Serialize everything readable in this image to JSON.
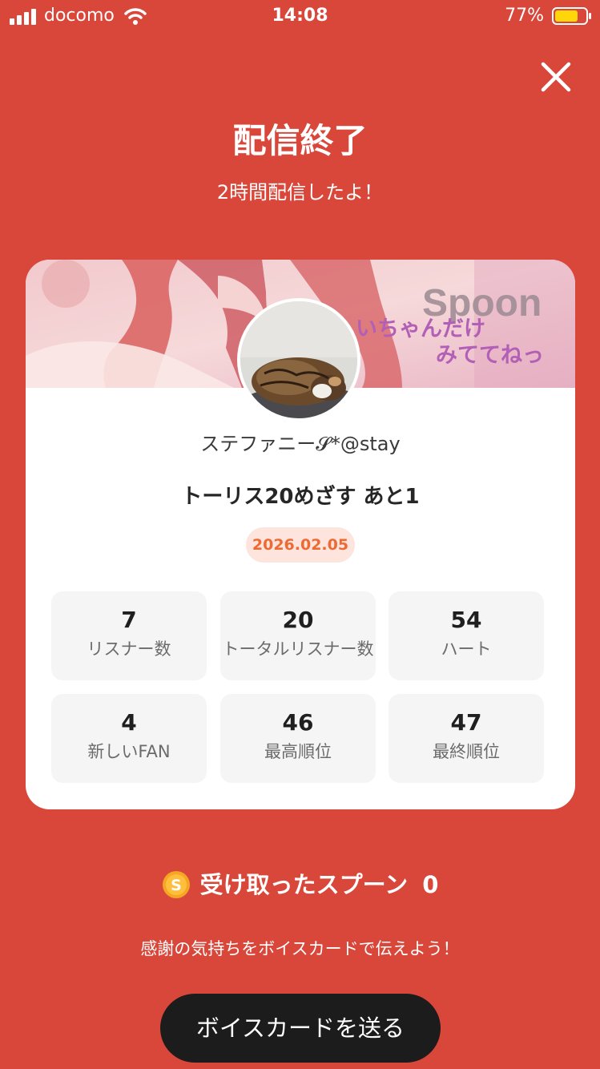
{
  "status_bar": {
    "carrier": "docomo",
    "time": "14:08",
    "battery": "77%",
    "battery_level": 0.77,
    "battery_color": "#ffd60a"
  },
  "header": {
    "close_icon": "close-icon",
    "title": "配信終了",
    "subtitle": "2時間配信したよ！"
  },
  "card": {
    "banner": {
      "brand": "Spoon",
      "line1": "いちゃんだけ",
      "line2": "みててねっ"
    },
    "username": "ステファニー𝓢*@stay",
    "live_title": "トーリス20めざす あと1",
    "date": "2026.02.05",
    "stats": [
      {
        "value": "7",
        "label": "リスナー数"
      },
      {
        "value": "20",
        "label": "トータルリスナー数"
      },
      {
        "value": "54",
        "label": "ハート"
      },
      {
        "value": "4",
        "label": "新しいFAN"
      },
      {
        "value": "46",
        "label": "最高順位"
      },
      {
        "value": "47",
        "label": "最終順位"
      }
    ]
  },
  "spoon": {
    "coin_icon": "spoon-coin-icon",
    "coin_letter": "S",
    "label": "受け取ったスプーン",
    "count": "0"
  },
  "footer": {
    "thanks_text": "感謝の気持ちをボイスカードで伝えよう！",
    "voice_card_button": "ボイスカードを送る"
  },
  "colors": {
    "background": "#d9463a",
    "date_badge_bg": "#fde4dc",
    "date_badge_text": "#ee6a34",
    "button_bg": "#1c1c1c"
  }
}
